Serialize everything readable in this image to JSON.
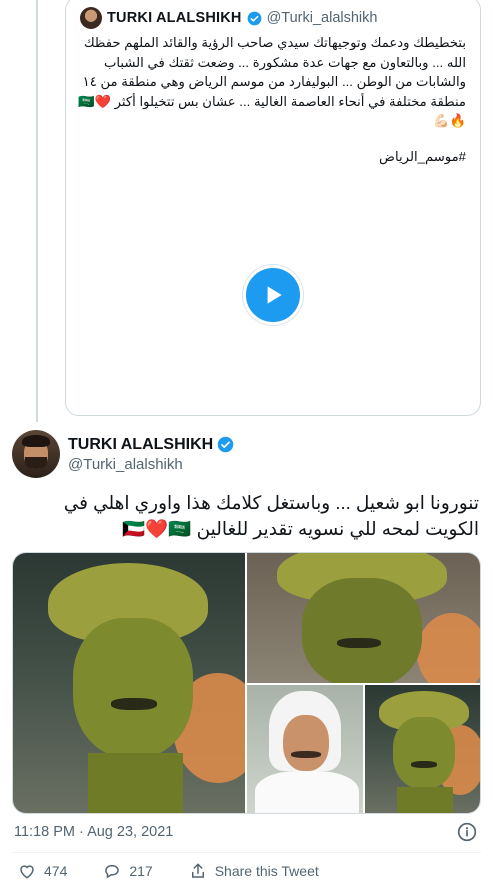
{
  "quoted_tweet": {
    "name": "TURKI ALALSHIKH",
    "handle": "@Turki_alalshikh",
    "text": "بتخطيطك ودعمك وتوجيهاتك سيدي صاحب الرؤية والقائد الملهم حفظك الله ... وبالتعاون مع جهات عدة مشكورة ... وضعت ثقتك في الشباب والشابات من الوطن ... البوليفارد من موسم الرياض وهي منطقة من ١٤ منطقة مختلفة في أنحاء العاصمة الغالية ... عشان بس تتخيلوا أكثر ❤️🇸🇦🔥💪🏻",
    "hashtag": "#موسم_الرياض",
    "play_icon": "play-icon"
  },
  "main_tweet": {
    "name": "TURKI ALALSHIKH",
    "handle": "@Turki_alalshikh",
    "text": "تنورونا ابو شعيل ... وباستغل كلامك هذا واوري اهلي في الكويت لمحه للي نسويه تقدير للغالين 🇰🇼❤️🇸🇦",
    "timestamp": "11:18 PM · Aug 23, 2021"
  },
  "actions": {
    "likes": "474",
    "replies": "217",
    "share_label": "Share this Tweet"
  },
  "colors": {
    "accent": "#1d9bf0",
    "secondary_text": "#536471",
    "border": "#cfd9de"
  }
}
